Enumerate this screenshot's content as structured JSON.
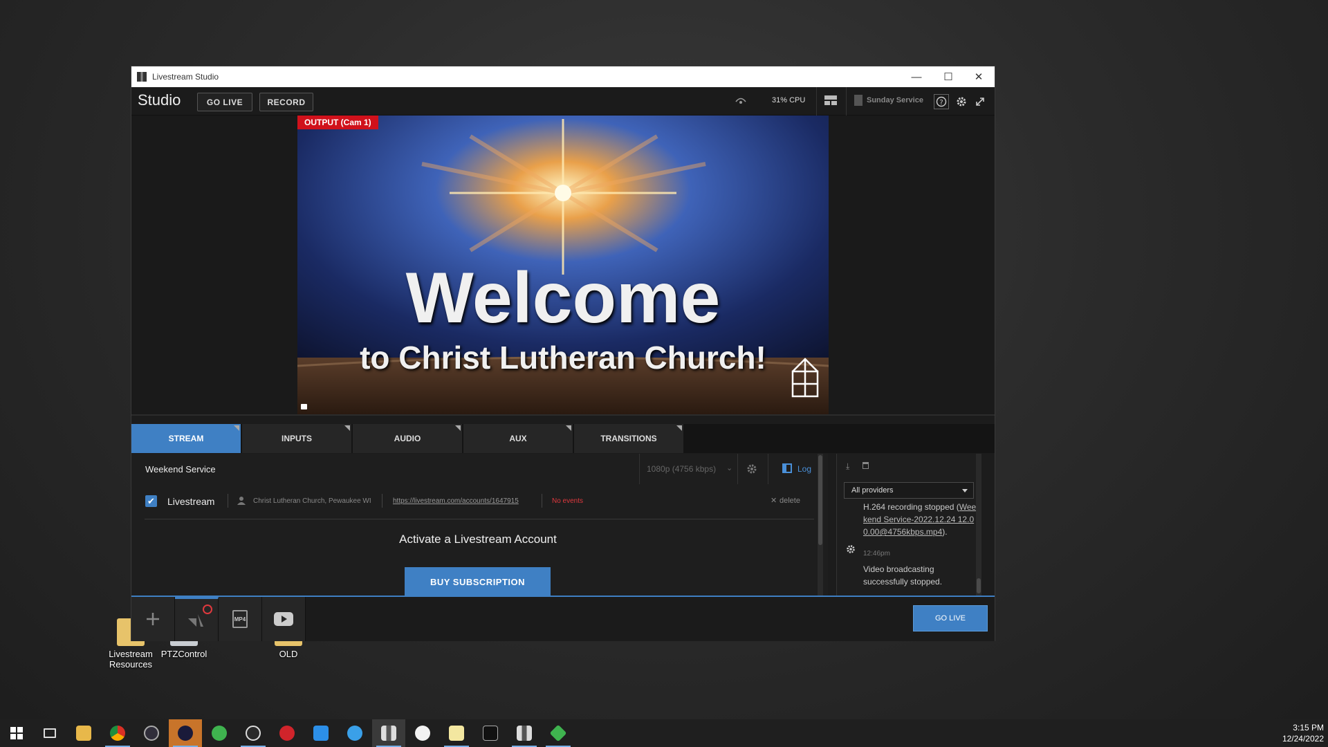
{
  "desktop": {
    "icons": [
      {
        "label_line1": "Livestream",
        "label_line2": "Resources"
      },
      {
        "label_line1": "PTZControl",
        "label_line2": ""
      },
      {
        "label_line1": "OLD",
        "label_line2": ""
      }
    ]
  },
  "window": {
    "title": "Livestream Studio",
    "controls": {
      "minimize": "—",
      "maximize": "☐",
      "close": "✕"
    }
  },
  "toolbar": {
    "app_name": "Studio",
    "go_live_label": "GO LIVE",
    "record_label": "RECORD",
    "cpu": "31% CPU",
    "project": "Sunday Service"
  },
  "preview": {
    "output_label": "OUTPUT (Cam 1)",
    "headline": "Welcome",
    "subline": "to Christ Lutheran Church!"
  },
  "tabs": [
    {
      "label": "STREAM",
      "active": true
    },
    {
      "label": "INPUTS",
      "active": false
    },
    {
      "label": "AUDIO",
      "active": false
    },
    {
      "label": "AUX",
      "active": false
    },
    {
      "label": "TRANSITIONS",
      "active": false
    }
  ],
  "stream": {
    "event_name": "Weekend Service",
    "quality": "1080p (4756 kbps)",
    "log_label": "Log",
    "provider": {
      "checked": true,
      "name": "Livestream",
      "account": "Christ Lutheran Church, Pewaukee WI",
      "url": "https://livestream.com/accounts/1647915",
      "status": "No events",
      "delete_label": "delete"
    },
    "activate_heading": "Activate a Livestream Account",
    "buy_label": "BUY SUBSCRIPTION"
  },
  "log": {
    "filter": "All providers",
    "entries": [
      {
        "time": "",
        "text_prefix": "H.264 recording stopped (",
        "link": "Weekend Service-2022.12.24 12.00.00@4756kbps.mp4",
        "text_suffix": ")."
      },
      {
        "time": "12:46pm",
        "text": "Video broadcasting successfully stopped."
      }
    ]
  },
  "bottom": {
    "go_live_label": "GO LIVE",
    "mp4_label": "MP4"
  },
  "taskbar": {
    "time": "3:15 PM",
    "date": "12/24/2022"
  },
  "colors": {
    "accent": "#3f80c4",
    "output_red": "#d0111b",
    "status_red": "#e0393e"
  }
}
